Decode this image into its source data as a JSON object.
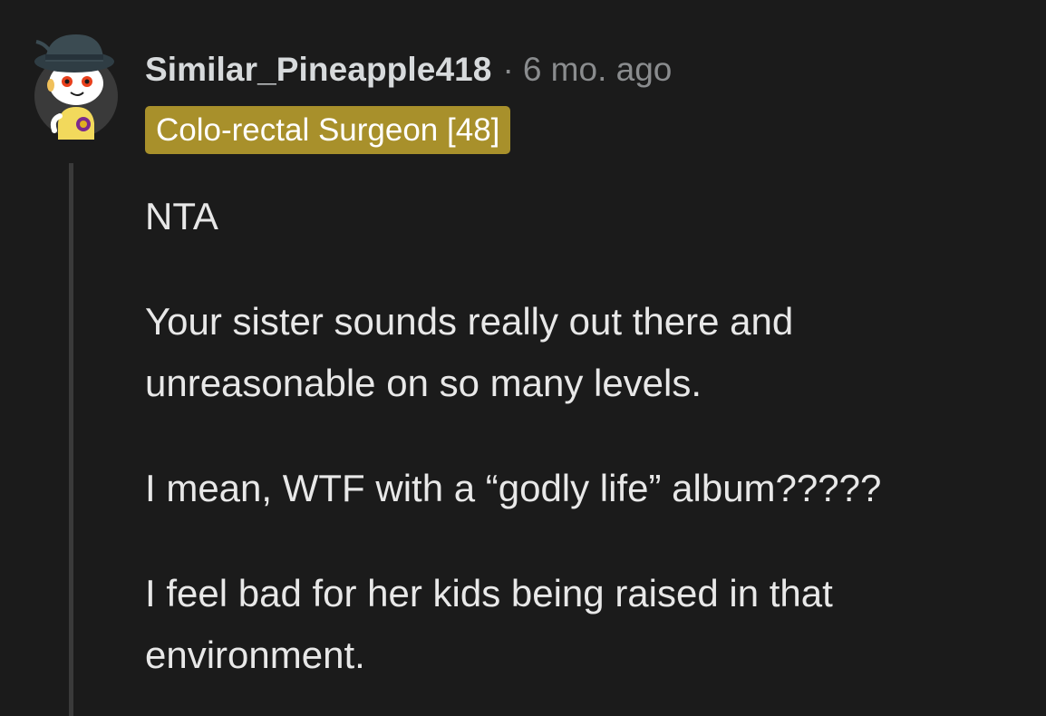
{
  "comment": {
    "author": "Similar_Pineapple418",
    "separator": "·",
    "time_ago": "6 mo. ago",
    "flair": "Colo-rectal Surgeon [48]",
    "paragraphs": [
      "NTA",
      "Your sister sounds really out there and unreasonable on so many levels.",
      "I mean, WTF with a “godly life” album?????",
      "I feel bad for her kids being raised in that environment."
    ]
  },
  "colors": {
    "background": "#1b1b1b",
    "flair_bg": "#a8902b",
    "username": "#d7dadc",
    "meta": "#8a8c8e",
    "thread_line": "#3a3a3a"
  },
  "icons": {
    "avatar": "snoo-avatar-icon"
  }
}
